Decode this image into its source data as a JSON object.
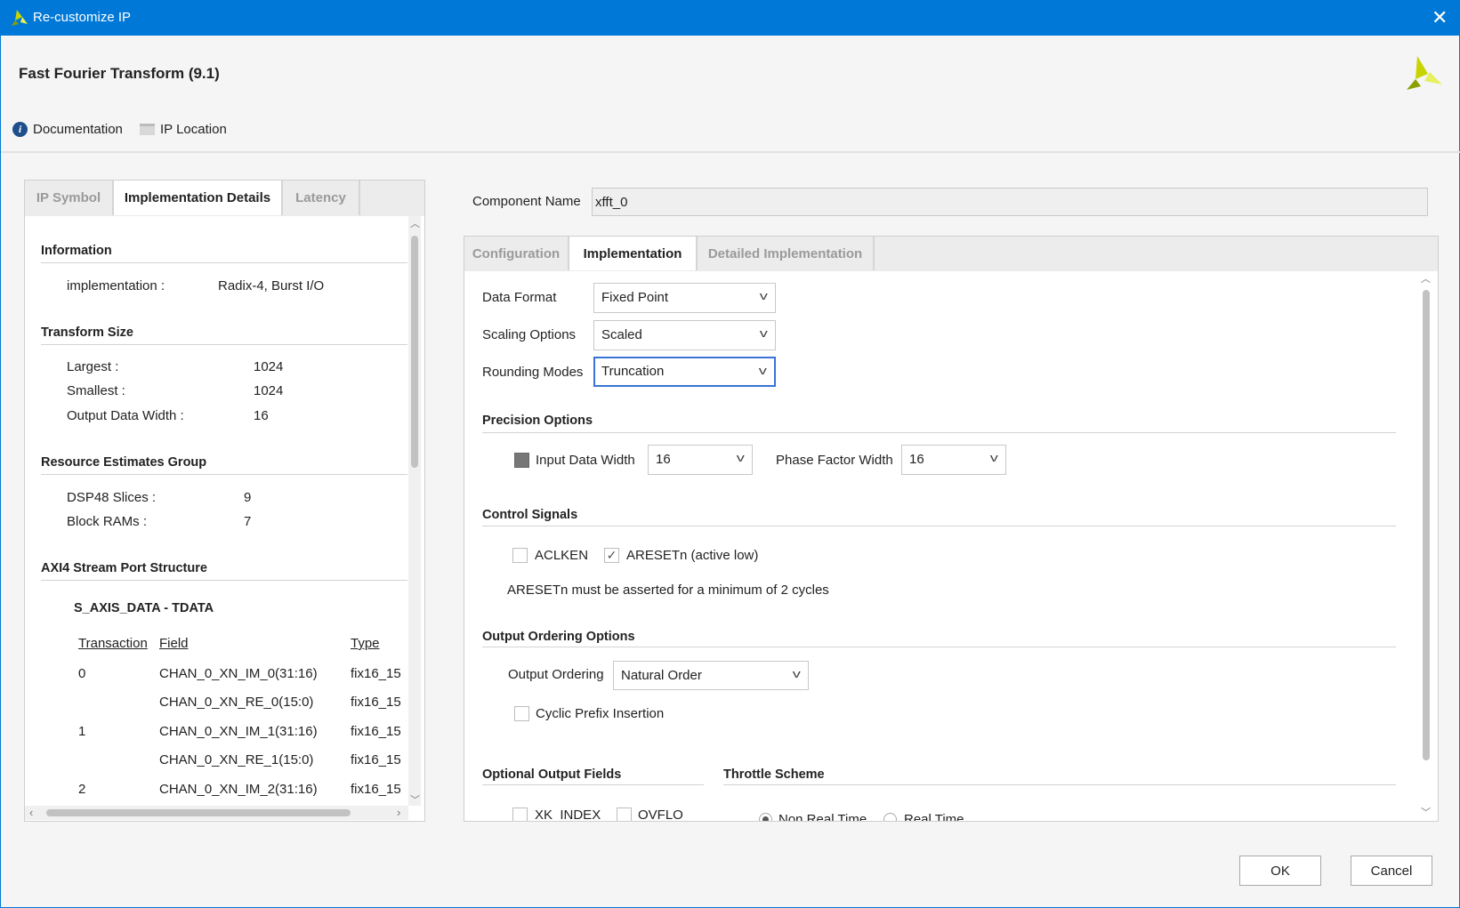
{
  "window": {
    "title": "Re-customize IP",
    "close_icon": "close-icon"
  },
  "header": {
    "title": "Fast Fourier Transform (9.1)",
    "documentation": "Documentation",
    "ip_location": "IP Location"
  },
  "left_panel": {
    "tabs": [
      {
        "label": "IP Symbol"
      },
      {
        "label": "Implementation Details",
        "active": true
      },
      {
        "label": "Latency"
      }
    ],
    "information": {
      "heading": "Information",
      "rows": [
        {
          "label": "implementation :",
          "value": "Radix-4, Burst I/O"
        }
      ]
    },
    "transform_size": {
      "heading": "Transform Size",
      "rows": [
        {
          "label": "Largest :",
          "value": "1024"
        },
        {
          "label": "Smallest :",
          "value": "1024"
        },
        {
          "label": "Output Data Width :",
          "value": "16"
        }
      ]
    },
    "resources": {
      "heading": "Resource Estimates Group",
      "rows": [
        {
          "label": "DSP48 Slices :",
          "value": "9"
        },
        {
          "label": "Block RAMs :",
          "value": "7"
        }
      ]
    },
    "axi": {
      "heading": "AXI4 Stream Port Structure",
      "subheading": "S_AXIS_DATA - TDATA",
      "columns": [
        "Transaction",
        "Field",
        "Type"
      ],
      "rows": [
        [
          "0",
          "CHAN_0_XN_IM_0(31:16)",
          "fix16_15"
        ],
        [
          "",
          "CHAN_0_XN_RE_0(15:0)",
          "fix16_15"
        ],
        [
          "1",
          "CHAN_0_XN_IM_1(31:16)",
          "fix16_15"
        ],
        [
          "",
          "CHAN_0_XN_RE_1(15:0)",
          "fix16_15"
        ],
        [
          "2",
          "CHAN_0_XN_IM_2(31:16)",
          "fix16_15"
        ]
      ]
    }
  },
  "right_panel": {
    "component_name_label": "Component Name",
    "component_name": "xfft_0",
    "tabs": [
      {
        "label": "Configuration"
      },
      {
        "label": "Implementation",
        "active": true
      },
      {
        "label": "Detailed Implementation"
      }
    ],
    "data_format": {
      "label": "Data Format",
      "value": "Fixed Point"
    },
    "scaling": {
      "label": "Scaling Options",
      "value": "Scaled"
    },
    "rounding": {
      "label": "Rounding Modes",
      "value": "Truncation"
    },
    "precision": {
      "heading": "Precision Options",
      "input_width_label": "Input Data Width",
      "input_width": "16",
      "phase_label": "Phase Factor Width",
      "phase": "16"
    },
    "control": {
      "heading": "Control Signals",
      "aclken": "ACLKEN",
      "aclken_checked": false,
      "aresetn": "ARESETn (active low)",
      "aresetn_checked": true,
      "note": "ARESETn must be asserted for a minimum of 2 cycles"
    },
    "ordering": {
      "heading": "Output Ordering Options",
      "label": "Output Ordering",
      "value": "Natural Order",
      "cyclic": "Cyclic Prefix Insertion",
      "cyclic_checked": false
    },
    "optional": {
      "heading": "Optional Output Fields",
      "xk_index": "XK_INDEX",
      "ovflo": "OVFLO"
    },
    "throttle": {
      "heading": "Throttle Scheme",
      "non_real_time": "Non Real Time",
      "real_time": "Real Time",
      "selected": "Non Real Time"
    }
  },
  "buttons": {
    "ok": "OK",
    "cancel": "Cancel"
  },
  "colors": {
    "titlebar": "#0078d7",
    "focus": "#3874d6",
    "logo_yellow": "#c8d400",
    "logo_green": "#8aa000"
  }
}
